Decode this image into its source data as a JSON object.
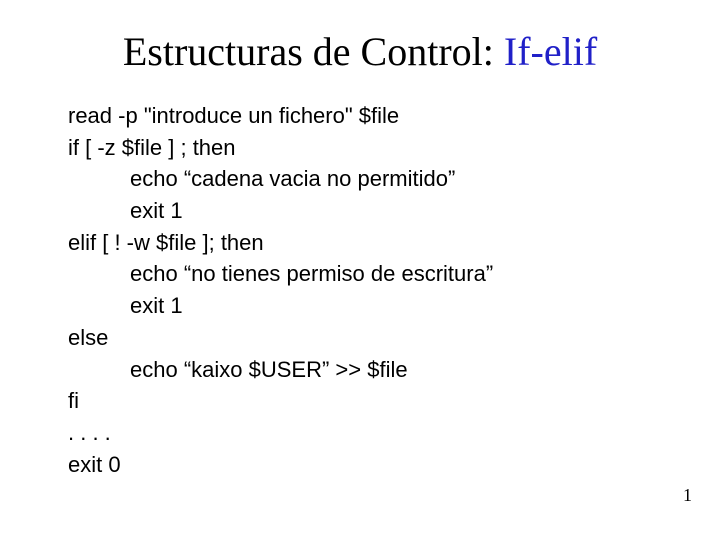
{
  "title": {
    "part1": "Estructuras de Control: ",
    "part2": "If-elif"
  },
  "lines": {
    "l1": "read -p  \"introduce un fichero\" $file",
    "l2": "if [ -z $file ] ; then",
    "l3": "echo “cadena vacia no permitido”",
    "l4": "exit 1",
    "l5": "elif  [ ! -w $file ]; then",
    "l6": "echo “no tienes permiso de escritura”",
    "l7": "exit 1",
    "l8": "else",
    "l9": "echo “kaixo $USER” >> $file",
    "l10": "fi",
    "l11": ". . . .",
    "l12": "exit 0"
  },
  "page_number": "1"
}
